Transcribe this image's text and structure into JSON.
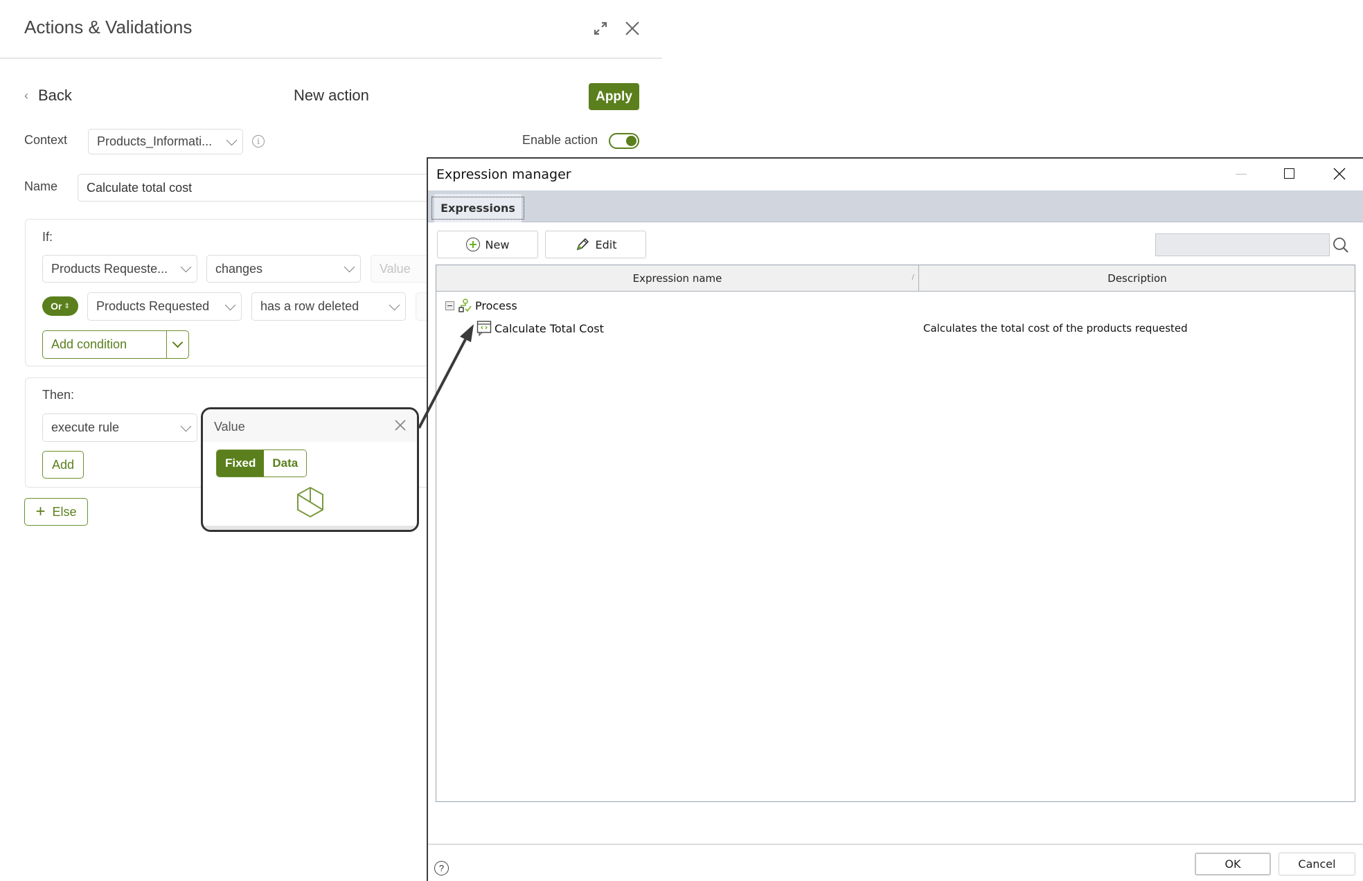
{
  "panel": {
    "title": "Actions & Validations",
    "back_label": "Back",
    "subtitle": "New action",
    "apply_label": "Apply",
    "context_label": "Context",
    "context_value": "Products_Informati...",
    "enable_action_label": "Enable action",
    "enable_action_on": true,
    "name_label": "Name",
    "name_value": "Calculate total cost",
    "if_section": {
      "label": "If:",
      "conditions": [
        {
          "field": "Products Requeste...",
          "operator": "changes",
          "value_placeholder": "Value"
        },
        {
          "connector": "Or",
          "field": "Products Requested",
          "operator": "has a row deleted"
        }
      ],
      "add_condition_label": "Add condition"
    },
    "then_section": {
      "label": "Then:",
      "action": "execute rule",
      "add_label": "Add"
    },
    "else_label": "Else",
    "value_popup": {
      "title": "Value",
      "modes": [
        "Fixed",
        "Data"
      ],
      "selected_mode": "Fixed"
    }
  },
  "dialog": {
    "title": "Expression manager",
    "tabs": [
      {
        "label": "Expressions",
        "active": true
      }
    ],
    "toolbar": {
      "new_label": "New",
      "edit_label": "Edit",
      "search_value": ""
    },
    "table": {
      "columns": [
        "Expression name",
        "Description"
      ],
      "rows": [
        {
          "name": "Process",
          "type": "group",
          "expanded": true,
          "description": ""
        },
        {
          "name": "Calculate Total Cost",
          "type": "expression",
          "description": "Calculates the total cost of the products requested"
        }
      ]
    },
    "footer": {
      "ok_label": "OK",
      "cancel_label": "Cancel"
    }
  },
  "colors": {
    "accent": "#5a7f1c",
    "tabstrip": "#d0d5de"
  }
}
